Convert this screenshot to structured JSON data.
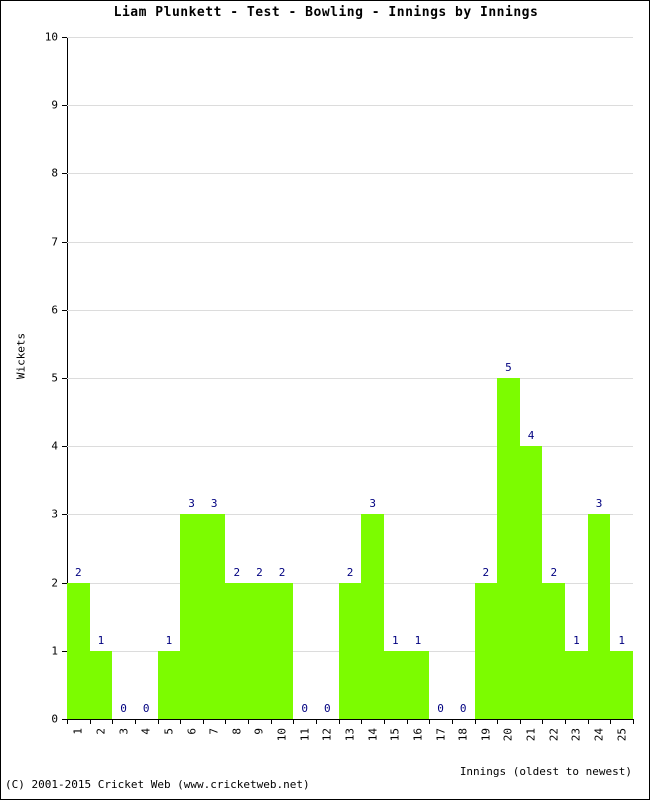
{
  "chart_data": {
    "type": "bar",
    "title": "Liam Plunkett - Test - Bowling - Innings by Innings",
    "xlabel": "Innings (oldest to newest)",
    "ylabel": "Wickets",
    "categories": [
      "1",
      "2",
      "3",
      "4",
      "5",
      "6",
      "7",
      "8",
      "9",
      "10",
      "11",
      "12",
      "13",
      "14",
      "15",
      "16",
      "17",
      "18",
      "19",
      "20",
      "21",
      "22",
      "23",
      "24",
      "25"
    ],
    "values": [
      2,
      1,
      0,
      0,
      1,
      3,
      3,
      2,
      2,
      2,
      0,
      0,
      2,
      3,
      1,
      1,
      0,
      0,
      2,
      5,
      4,
      2,
      1,
      3,
      1
    ],
    "data_labels": [
      "2",
      "1",
      "0",
      "0",
      "1",
      "3",
      "3",
      "2",
      "2",
      "2",
      "0",
      "0",
      "2",
      "3",
      "1",
      "1",
      "0",
      "0",
      "2",
      "5",
      "4",
      "2",
      "1",
      "3",
      "1"
    ],
    "ylim": [
      0,
      10
    ],
    "yticks": [
      0,
      1,
      2,
      3,
      4,
      5,
      6,
      7,
      8,
      9,
      10
    ],
    "ytick_labels": [
      "0",
      "1",
      "2",
      "3",
      "4",
      "5",
      "6",
      "7",
      "8",
      "9",
      "10"
    ],
    "grid": true,
    "legend": false,
    "bar_color": "#7cfc00",
    "label_color": "#000080",
    "grid_color": "#dcdcdc",
    "axis_color": "#000000"
  },
  "footer": {
    "copyright": "(C) 2001-2015 Cricket Web (www.cricketweb.net)"
  }
}
